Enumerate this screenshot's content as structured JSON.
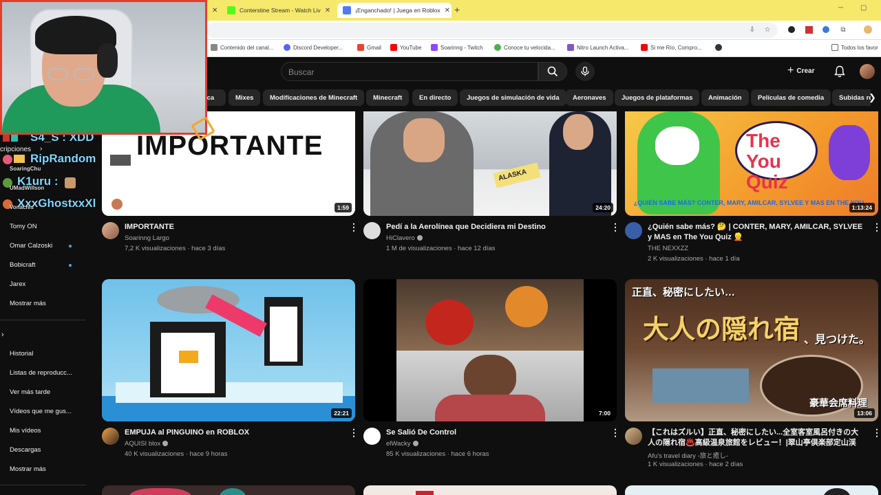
{
  "browser": {
    "tabs": [
      {
        "title": "Conterstine Stream - Watch Liv",
        "favicon_color": "#53fc18"
      },
      {
        "title": "¡Enganchado! | Juega en Roblox",
        "favicon_color": "#4f7cf2"
      }
    ],
    "new_tab": "+",
    "bookmarks": [
      {
        "label": "Contenido del canal...",
        "color": "#888888"
      },
      {
        "label": "Discord Developer...",
        "color": "#5865f2"
      },
      {
        "label": "Gmail",
        "color": "#ea4335"
      },
      {
        "label": "YouTube",
        "color": "#ff0000"
      },
      {
        "label": "Soarinng - Twitch",
        "color": "#9146ff"
      },
      {
        "label": "Conoce tu velocida...",
        "color": "#4caf50"
      },
      {
        "label": "Nitro Launch Activa...",
        "color": "#7e57c2"
      },
      {
        "label": "Si me Río, Compro...",
        "color": "#ff0000"
      },
      {
        "label": "",
        "color": "#333333"
      }
    ],
    "bookmarks_folder": "Todos los favor"
  },
  "masthead": {
    "search_placeholder": "Buscar",
    "create_label": "Crear"
  },
  "chips": [
    "ica",
    "Mixes",
    "Modificaciones de Minecraft",
    "Minecraft",
    "En directo",
    "Juegos de simulación de vida",
    "Aeronaves",
    "Juegos de plataformas",
    "Animación",
    "Películas de comedia",
    "Subidas re"
  ],
  "sidebar": {
    "subscriptions_header": "cripciones",
    "subscriptions": [
      {
        "label": "Tomy ON",
        "live": false
      },
      {
        "label": "Omar Calzoski",
        "live": true
      },
      {
        "label": "Bobicraft",
        "live": true
      },
      {
        "label": "Jarex",
        "live": false
      }
    ],
    "show_more_1": "Mostrar más",
    "you_items": [
      "Historial",
      "Listas de reproducc...",
      "Ver más tarde",
      "Vídeos que me gus...",
      "Mis vídeos",
      "Descargas"
    ],
    "show_more_2": "Mostrar más"
  },
  "chat": [
    {
      "text": "S4_S : XDD",
      "style": "big"
    },
    {
      "text": "RipRandom",
      "style": "big"
    },
    {
      "text": "SoaringChu",
      "style": "small"
    },
    {
      "text": "K1uru :",
      "style": "big"
    },
    {
      "text": "UMadWillson",
      "style": "small"
    },
    {
      "text": "XxxGhostxxXl",
      "style": "big"
    },
    {
      "text": "Vonachis",
      "style": "small"
    }
  ],
  "videos": [
    {
      "title": "IMPORTANTE",
      "channel": "Soarinng Largo",
      "verified": false,
      "meta": "7,2 K visualizaciones · hace 3 días",
      "duration": "1:59",
      "thumb_text": "IMPORTANTE"
    },
    {
      "title": "Pedí a la Aerolínea que Decidiera mi Destino",
      "channel": "HiClavero",
      "verified": true,
      "meta": "1 M de visualizaciones · hace 12 días",
      "duration": "24:20",
      "thumb_text": "ALASKA"
    },
    {
      "title": "¿Quién sabe más? 🤔 | CONTER, MARY, AMILCAR, SYLVEE y MAS en The You Quiz 👱",
      "channel": "THE NEXXZZ",
      "verified": false,
      "meta": "2 K visualizaciones · hace 1 día",
      "duration": "1:13:24",
      "thumb_text": "The You Quiz",
      "thumb_caption": "¿QUIÉN SABE MÁS? CONTER, MARY, AMILCAR, SYLVEE Y MAS EN THE YOU"
    },
    {
      "title": "EMPUJA al PINGUINO en ROBLOX",
      "channel": "AQUISI blox",
      "verified": true,
      "meta": "40 K visualizaciones · hace 9 horas",
      "duration": "22:21"
    },
    {
      "title": "Se Salió De Control",
      "channel": "elWacky",
      "verified": true,
      "meta": "85 K visualizaciones · hace 6 horas",
      "duration": "7:00"
    },
    {
      "title": "【これはズルい】正直、秘密にしたい...全室客室風呂付きの大人の隠れ宿♨️高級温泉旅館をレビュー！|翠山亭倶楽部定山渓",
      "channel": "Afu's travel diary -旅と癒し-",
      "verified": false,
      "meta": "1 K visualizaciones · hace 2 días",
      "duration": "13:06",
      "thumb_text": "大人の隠れ宿",
      "thumb_top": "正直、秘密にしたい…",
      "thumb_side": "、見つけた。",
      "thumb_corner": "豪華会席料理"
    }
  ]
}
